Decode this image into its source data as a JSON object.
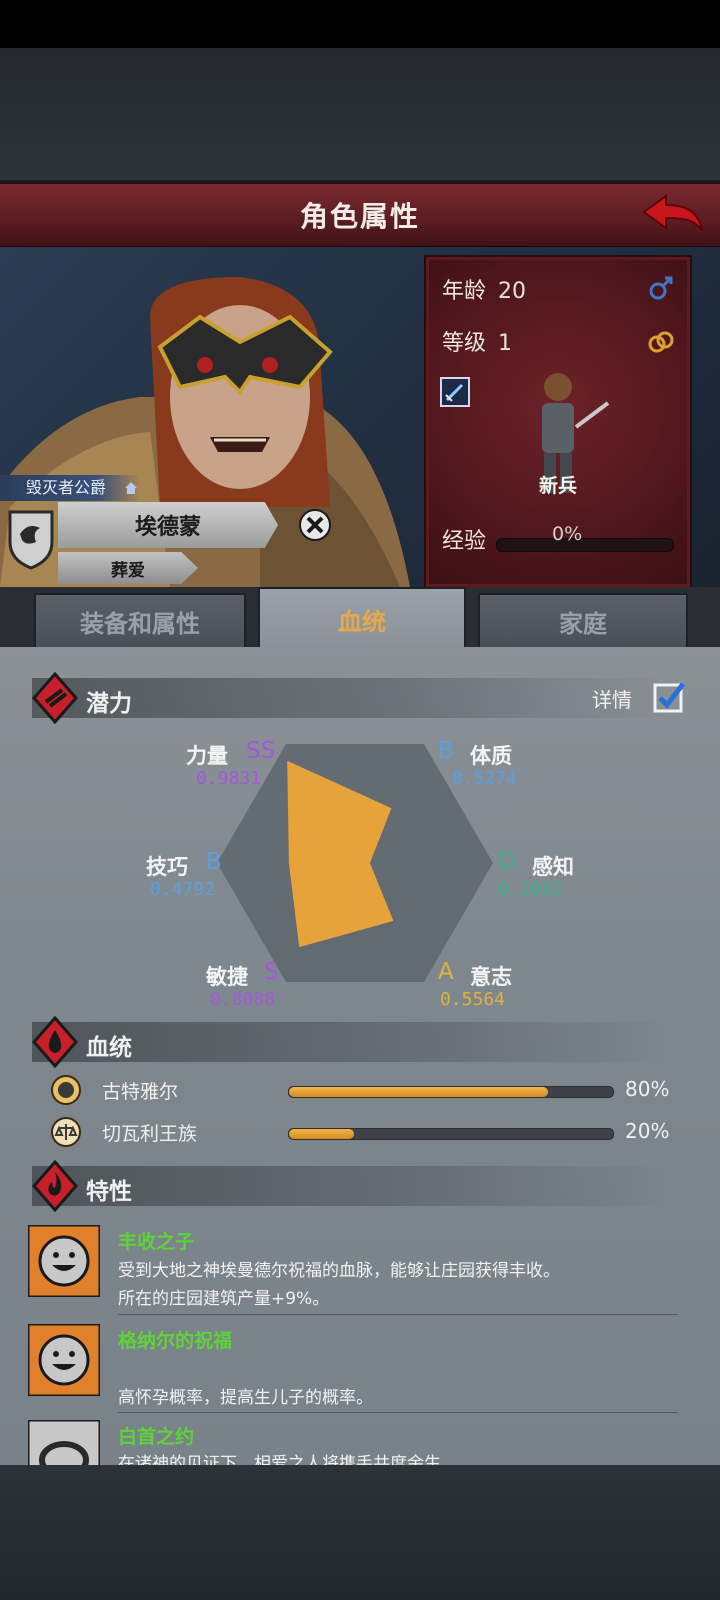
{
  "header": {
    "title": "角色属性"
  },
  "character": {
    "title_tag": "毁灭者公爵",
    "name": "埃德蒙",
    "spouse": "葬爱"
  },
  "info": {
    "age_label": "年龄",
    "age_value": "20",
    "level_label": "等级",
    "level_value": "1",
    "rank": "新兵",
    "xp_label": "经验",
    "xp_value": "0%"
  },
  "tabs": [
    {
      "label": "装备和属性"
    },
    {
      "label": "血统"
    },
    {
      "label": "家庭"
    }
  ],
  "potential": {
    "heading": "潜力",
    "detail_label": "详情",
    "stats": [
      {
        "name": "力量",
        "grade": "SS",
        "value": "0.9831"
      },
      {
        "name": "体质",
        "grade": "B",
        "value": "0.5274"
      },
      {
        "name": "感知",
        "grade": "D",
        "value": "0.1082"
      },
      {
        "name": "意志",
        "grade": "A",
        "value": "0.5564"
      },
      {
        "name": "敏捷",
        "grade": "S",
        "value": "0.8088"
      },
      {
        "name": "技巧",
        "grade": "B",
        "value": "0.4792"
      }
    ]
  },
  "lineage": {
    "heading": "血统",
    "items": [
      {
        "name": "古特雅尔",
        "percent_text": "80%",
        "fraction": 0.8
      },
      {
        "name": "切瓦利王族",
        "percent_text": "20%",
        "fraction": 0.2
      }
    ]
  },
  "traits": {
    "heading": "特性",
    "items": [
      {
        "name": "丰收之子",
        "desc1": "受到大地之神埃曼德尔祝福的血脉，能够让庄园获得丰收。",
        "desc2": "所在的庄园建筑产量+9%。"
      },
      {
        "name": "格纳尔的祝福",
        "desc1": "",
        "desc2": "高怀孕概率，提高生儿子的概率。"
      },
      {
        "name": "白首之约",
        "desc1": "在诸神的见证下，相爱之人将携手共度余生。",
        "desc2": ""
      }
    ]
  },
  "colors": {
    "grade_ss": "#a05ad8",
    "grade_s": "#a05ad8",
    "grade_b": "#5aa0e0",
    "grade_d": "#3fb08a",
    "grade_a": "#e0b040",
    "radar_fill": "#e8a23a",
    "trait_name": "#5fd23a"
  }
}
